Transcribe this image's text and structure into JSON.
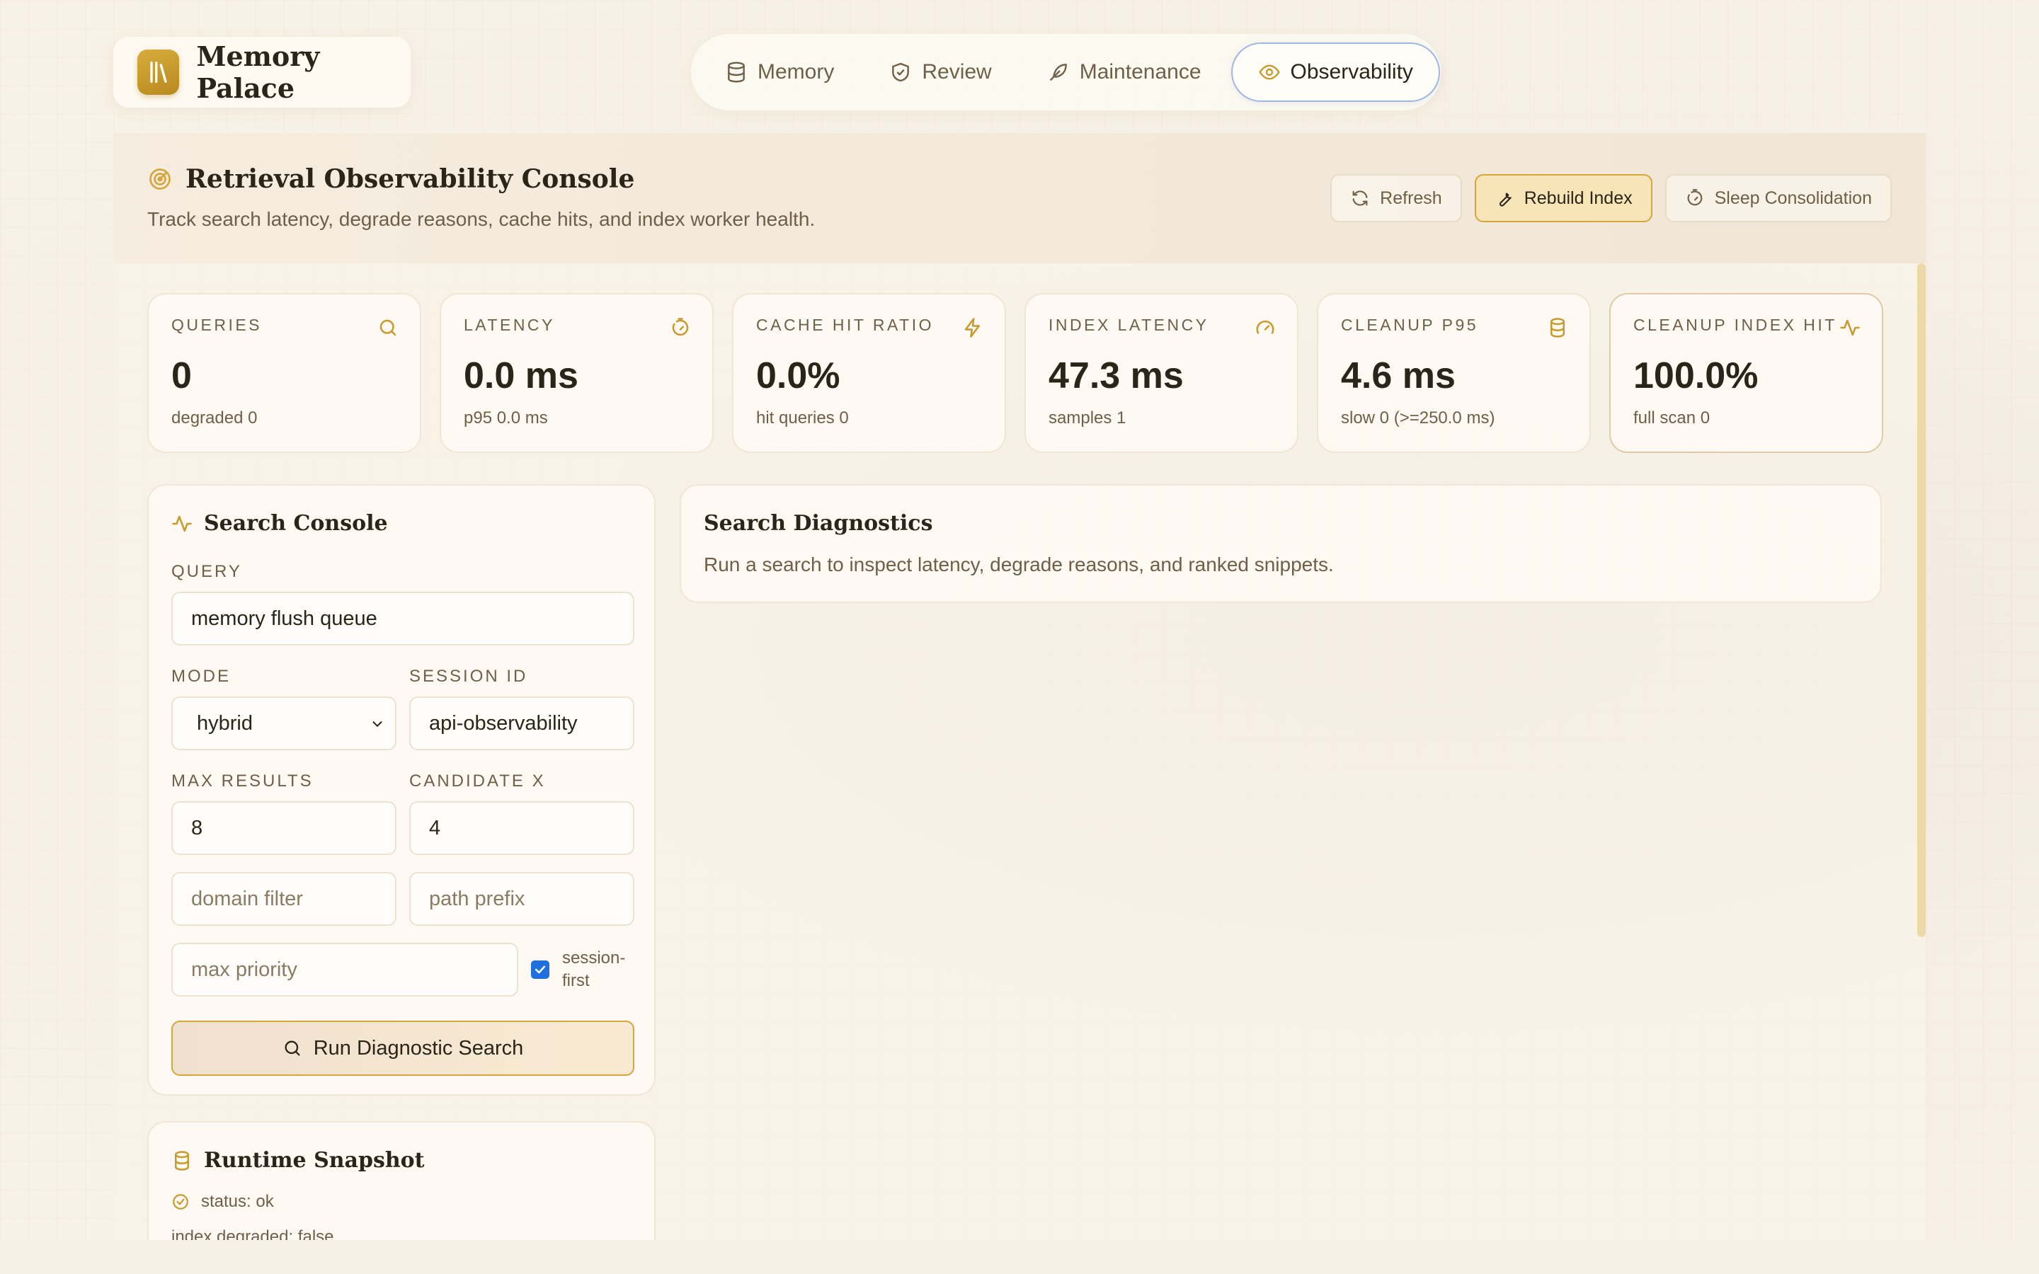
{
  "brand": {
    "title": "Memory Palace"
  },
  "nav": [
    {
      "label": "Memory",
      "icon": "database-icon"
    },
    {
      "label": "Review",
      "icon": "shield-check-icon"
    },
    {
      "label": "Maintenance",
      "icon": "feather-icon"
    },
    {
      "label": "Observability",
      "icon": "eye-icon",
      "active": true
    }
  ],
  "console": {
    "title": "Retrieval Observability Console",
    "subtitle": "Track search latency, degrade reasons, cache hits, and index worker health.",
    "actions": {
      "refresh": "Refresh",
      "rebuild": "Rebuild Index",
      "sleep": "Sleep Consolidation"
    }
  },
  "stats": [
    {
      "label": "QUERIES",
      "value": "0",
      "sub": "degraded 0",
      "icon": "search-icon"
    },
    {
      "label": "LATENCY",
      "value": "0.0 ms",
      "sub": "p95 0.0 ms",
      "icon": "timer-icon"
    },
    {
      "label": "CACHE HIT RATIO",
      "value": "0.0%",
      "sub": "hit queries 0",
      "icon": "lightning-icon"
    },
    {
      "label": "INDEX LATENCY",
      "value": "47.3 ms",
      "sub": "samples 1",
      "icon": "gauge-icon"
    },
    {
      "label": "CLEANUP P95",
      "value": "4.6 ms",
      "sub": "slow 0 (>=250.0 ms)",
      "icon": "database-icon"
    },
    {
      "label": "CLEANUP INDEX HIT",
      "value": "100.0%",
      "sub": "full scan 0",
      "icon": "activity-icon"
    }
  ],
  "search": {
    "title": "Search Console",
    "query_label": "QUERY",
    "query_value": "memory flush queue",
    "mode_label": "MODE",
    "mode_value": "hybrid",
    "session_label": "SESSION ID",
    "session_value": "api-observability",
    "max_results_label": "MAX RESULTS",
    "max_results_value": "8",
    "candidate_label": "CANDIDATE X",
    "candidate_value": "4",
    "domain_placeholder": "domain filter",
    "path_placeholder": "path prefix",
    "priority_placeholder": "max priority",
    "session_first_label": "session-first",
    "session_first_checked": true,
    "run_label": "Run Diagnostic Search"
  },
  "runtime": {
    "title": "Runtime Snapshot",
    "status": "status: ok",
    "index_degraded": "index degraded: false"
  },
  "diagnostics": {
    "title": "Search Diagnostics",
    "text": "Run a search to inspect latency, degrade reasons, and ranked snippets."
  }
}
